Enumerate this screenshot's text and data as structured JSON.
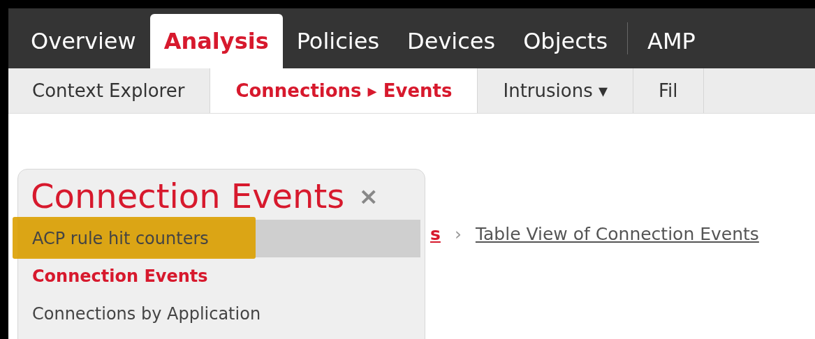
{
  "main_tabs": [
    {
      "label": "Overview",
      "selected": false
    },
    {
      "label": "Analysis",
      "selected": true
    },
    {
      "label": "Policies",
      "selected": false
    },
    {
      "label": "Devices",
      "selected": false
    },
    {
      "label": "Objects",
      "selected": false
    },
    {
      "label": "AMP",
      "selected": false,
      "divider_before": true
    }
  ],
  "sub_tabs": [
    {
      "label": "Context Explorer",
      "selected": false
    },
    {
      "label": "Connections ▸ Events",
      "selected": true
    },
    {
      "label": "Intrusions ▾",
      "selected": false
    },
    {
      "label": "Fil",
      "selected": false
    }
  ],
  "breadcrumb": {
    "cut_link": "s",
    "separator": "›",
    "link": "Table View of Connection Events"
  },
  "popup": {
    "title": "Connection Events",
    "close": "×",
    "items": [
      {
        "label": "ACP rule hit counters",
        "highlighted": true,
        "annotated": true,
        "current": false
      },
      {
        "label": "Connection Events",
        "highlighted": false,
        "annotated": false,
        "current": true
      },
      {
        "label": "Connections by Application",
        "highlighted": false,
        "annotated": false,
        "current": false
      }
    ]
  }
}
